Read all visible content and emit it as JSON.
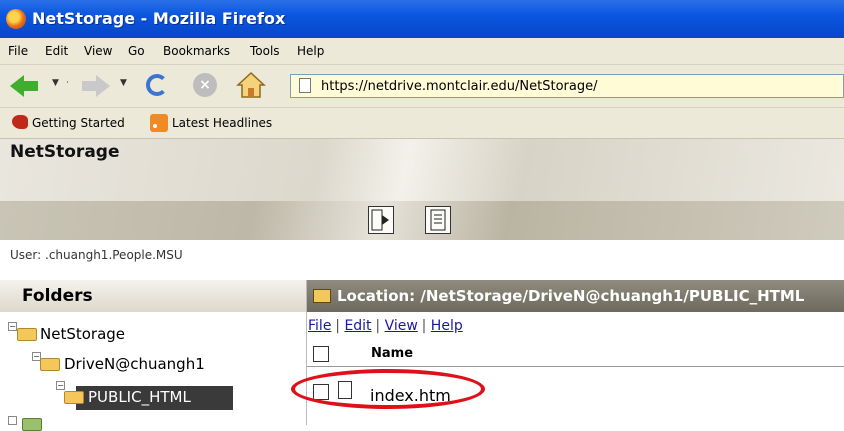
{
  "window": {
    "title": "NetStorage - Mozilla Firefox"
  },
  "menubar": [
    "File",
    "Edit",
    "View",
    "Go",
    "Bookmarks",
    "Tools",
    "Help"
  ],
  "navbar": {
    "url": "https://netdrive.montclair.edu/NetStorage/"
  },
  "bookmarks": [
    "Getting Started",
    "Latest Headlines"
  ],
  "app": {
    "title": "NetStorage",
    "user": "User: .chuangh1.People.MSU"
  },
  "folders": {
    "heading": "Folders",
    "tree": [
      "NetStorage",
      "DriveN@chuangh1",
      "PUBLIC_HTML"
    ]
  },
  "location": {
    "label": "Location: /NetStorage/DriveN@chuangh1/PUBLIC_HTML",
    "menu": [
      "File",
      "Edit",
      "View",
      "Help"
    ],
    "column_name": "Name",
    "files": [
      "index.htm"
    ]
  },
  "colors": {
    "highlight_ring": "#e0101a",
    "titlebar": "#0a56e0"
  }
}
